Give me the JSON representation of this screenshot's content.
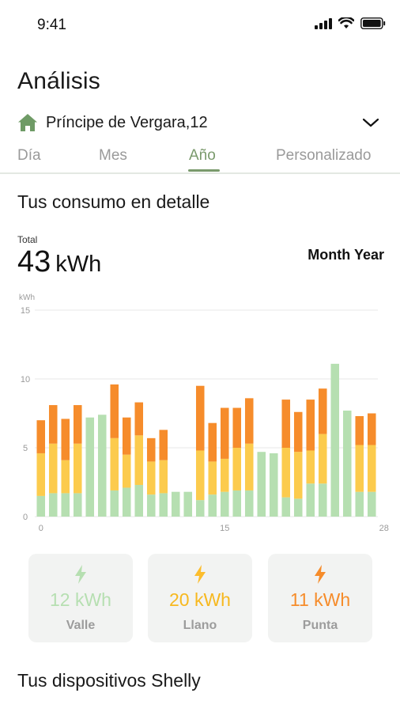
{
  "status": {
    "time": "9:41"
  },
  "page": {
    "title": "Análisis",
    "address": "Príncipe de Vergara,12",
    "tabs": [
      {
        "label": "Día"
      },
      {
        "label": "Mes"
      },
      {
        "label": "Año"
      },
      {
        "label": "Personalizado"
      }
    ],
    "active_tab": "Año"
  },
  "consumo": {
    "title": "Tus consumo en detalle",
    "total_label": "Total",
    "total_value": "43",
    "total_unit": "kWh",
    "period": "Month Year"
  },
  "colors": {
    "valle": "#b6dfb1",
    "llano": "#fccb4d",
    "punta": "#f68c2b",
    "accent": "#7a9a6c"
  },
  "chart_data": {
    "type": "bar",
    "stacked": true,
    "ylabel": "kWh",
    "ylim": [
      0,
      15
    ],
    "y_ticks": [
      "0",
      "5",
      "10",
      "15"
    ],
    "x_ticks": [
      "0",
      "15",
      "28"
    ],
    "grid": true,
    "series": [
      {
        "name": "Valle",
        "values": [
          1.5,
          1.7,
          1.7,
          1.7,
          7.2,
          7.4,
          1.9,
          2.1,
          2.3,
          1.6,
          1.7,
          1.8,
          1.8,
          1.2,
          1.6,
          1.8,
          1.9,
          1.9,
          4.7,
          4.6,
          1.4,
          1.3,
          2.4,
          2.4,
          11.1,
          7.7,
          1.8,
          1.8
        ]
      },
      {
        "name": "Llano",
        "values": [
          3.1,
          3.6,
          2.4,
          3.6,
          0,
          0,
          3.8,
          2.4,
          3.6,
          2.4,
          2.4,
          0,
          0,
          3.6,
          2.4,
          2.4,
          3.1,
          3.4,
          0,
          0,
          3.6,
          3.4,
          2.4,
          3.6,
          0,
          0,
          3.4,
          3.4
        ]
      },
      {
        "name": "Punta",
        "values": [
          2.4,
          2.8,
          3.0,
          2.8,
          0,
          0,
          3.9,
          2.7,
          2.4,
          1.7,
          2.2,
          0,
          0,
          4.7,
          2.8,
          3.7,
          2.9,
          3.3,
          0,
          0,
          3.5,
          2.9,
          3.7,
          3.3,
          0,
          0,
          2.1,
          2.3
        ]
      }
    ]
  },
  "summary": [
    {
      "value": "12 kWh",
      "label": "Valle"
    },
    {
      "value": "20 kWh",
      "label": "Llano"
    },
    {
      "value": "11 kWh",
      "label": "Punta"
    }
  ],
  "devices": {
    "title": "Tus dispositivos Shelly"
  }
}
